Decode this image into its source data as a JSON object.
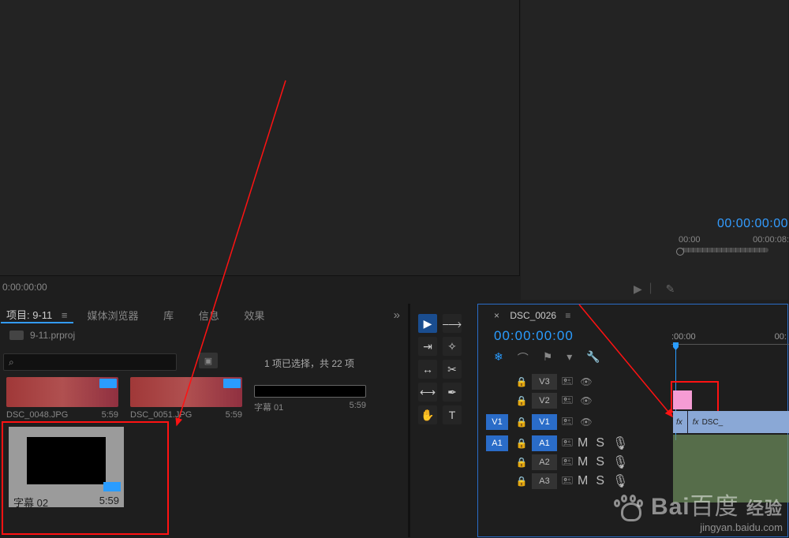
{
  "preview": {
    "tc_small": "0:00:00:00",
    "tc_blue": "00:00:00:00",
    "ruler_start": "00:00",
    "ruler_end": "00:00:08:"
  },
  "project": {
    "tab_label": "项目: 9-11",
    "nav": {
      "browser": "媒体浏览器",
      "library": "库",
      "info": "信息",
      "effects": "效果"
    },
    "file": "9-11.prproj",
    "search_placeholder": "",
    "selection_info": "1 项已选择，共 22 项",
    "items": [
      {
        "name": "DSC_0048.JPG",
        "dur": "5:59"
      },
      {
        "name": "DSC_0051.JPG",
        "dur": "5:59"
      },
      {
        "name": "字幕 01",
        "dur": "5:59"
      }
    ],
    "selected_item": {
      "name": "字幕 02",
      "dur": "5:59"
    }
  },
  "tools": [
    "selection",
    "track-select",
    "ripple",
    "rolling",
    "rate",
    "razor",
    "slip",
    "pen",
    "hand",
    "type"
  ],
  "timeline": {
    "tab": "DSC_0026",
    "tc": "00:00:00:00",
    "ruler_start": ":00:00",
    "ruler_end": "00:",
    "tracks_v": [
      {
        "name": "V3",
        "src": ""
      },
      {
        "name": "V2",
        "src": ""
      },
      {
        "name": "V1",
        "src": "V1",
        "selected": true
      }
    ],
    "tracks_a": [
      {
        "name": "A1",
        "src": "A1"
      },
      {
        "name": "A2",
        "src": ""
      },
      {
        "name": "A3",
        "src": ""
      }
    ],
    "clip_v1": "DSC_"
  },
  "watermark": {
    "brand": "Bai",
    "brand_cn": "百度",
    "sub": "经验",
    "url": "jingyan.baidu.com"
  }
}
